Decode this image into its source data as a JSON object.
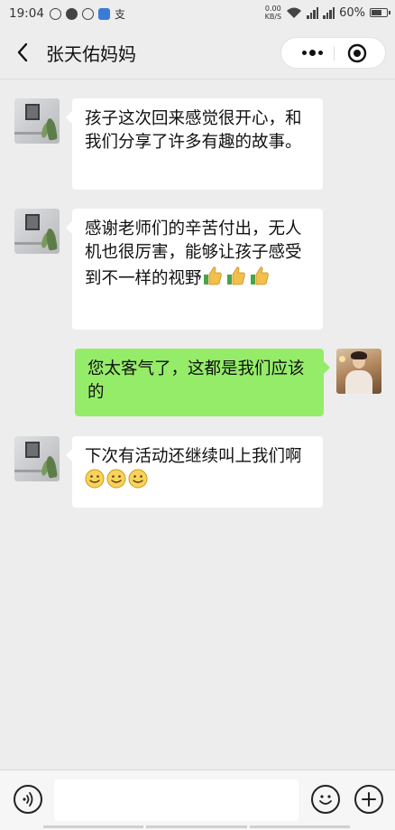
{
  "status_bar": {
    "time": "19:04",
    "pay_label": "支",
    "net_speed_value": "0.00",
    "net_speed_unit": "KB/S",
    "battery_percent": "60%"
  },
  "header": {
    "title": "张天佑妈妈"
  },
  "messages": [
    {
      "sender": "friend",
      "text": "孩子这次回来感觉很开心，和我们分享了许多有趣的故事。",
      "emoji": []
    },
    {
      "sender": "friend",
      "text": "感谢老师们的辛苦付出，无人机也很厉害，能够让孩子感受到不一样的视野",
      "emoji": [
        "thumbs-up",
        "thumbs-up",
        "thumbs-up"
      ]
    },
    {
      "sender": "me",
      "text": "您太客气了，这都是我们应该的",
      "emoji": []
    },
    {
      "sender": "friend",
      "text": "下次有活动还继续叫上我们啊",
      "emoji": [
        "smile",
        "smile",
        "smile"
      ]
    }
  ],
  "input": {
    "value": "",
    "placeholder": ""
  },
  "colors": {
    "background": "#ededed",
    "bubble_in": "#ffffff",
    "bubble_out": "#95ec69"
  },
  "icons": {
    "back": "chevron-left-icon",
    "more": "more-dots-icon",
    "close": "target-close-icon",
    "voice": "voice-icon",
    "emoji": "emoji-smile-icon",
    "plus": "plus-icon"
  }
}
